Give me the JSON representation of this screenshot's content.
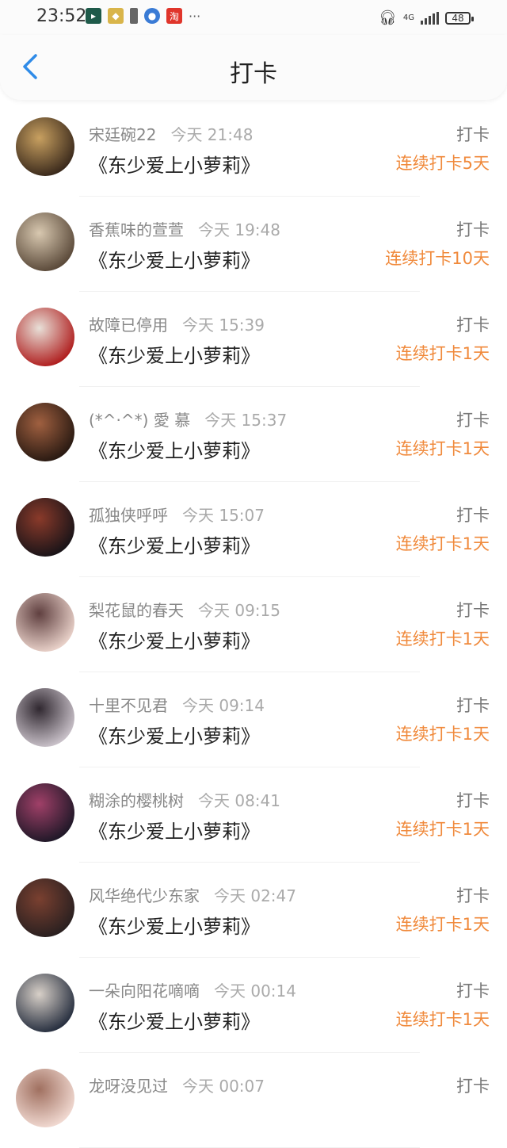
{
  "status_bar": {
    "time": "23:52",
    "network": "4G",
    "battery": "48",
    "more": "···",
    "taobao_label": "淘"
  },
  "header": {
    "title": "打卡"
  },
  "checkins": [
    {
      "name": "宋廷碗22",
      "time": "今天 21:48",
      "book": "《东少爱上小萝莉》",
      "action": "打卡",
      "streak": "连续打卡5天"
    },
    {
      "name": "香蕉味的萱萱",
      "time": "今天 19:48",
      "book": "《东少爱上小萝莉》",
      "action": "打卡",
      "streak": "连续打卡10天"
    },
    {
      "name": "故障已停用",
      "time": "今天 15:39",
      "book": "《东少爱上小萝莉》",
      "action": "打卡",
      "streak": "连续打卡1天"
    },
    {
      "name": "(*^·^*) 愛 慕",
      "time": "今天 15:37",
      "book": "《东少爱上小萝莉》",
      "action": "打卡",
      "streak": "连续打卡1天"
    },
    {
      "name": "孤独侠呼呼",
      "time": "今天 15:07",
      "book": "《东少爱上小萝莉》",
      "action": "打卡",
      "streak": "连续打卡1天"
    },
    {
      "name": "梨花鼠的春天",
      "time": "今天 09:15",
      "book": "《东少爱上小萝莉》",
      "action": "打卡",
      "streak": "连续打卡1天"
    },
    {
      "name": "十里不见君",
      "time": "今天 09:14",
      "book": "《东少爱上小萝莉》",
      "action": "打卡",
      "streak": "连续打卡1天"
    },
    {
      "name": "糊涂的樱桃树",
      "time": "今天 08:41",
      "book": "《东少爱上小萝莉》",
      "action": "打卡",
      "streak": "连续打卡1天"
    },
    {
      "name": "风华绝代少东家",
      "time": "今天 02:47",
      "book": "《东少爱上小萝莉》",
      "action": "打卡",
      "streak": "连续打卡1天"
    },
    {
      "name": "一朵向阳花嘀嘀",
      "time": "今天 00:14",
      "book": "《东少爱上小萝莉》",
      "action": "打卡",
      "streak": "连续打卡1天"
    },
    {
      "name": "龙呀没见过",
      "time": "今天 00:07",
      "book": "",
      "action": "打卡",
      "streak": ""
    }
  ],
  "colors": {
    "accent_blue": "#2f8be8",
    "streak_orange": "#f08a3c"
  }
}
